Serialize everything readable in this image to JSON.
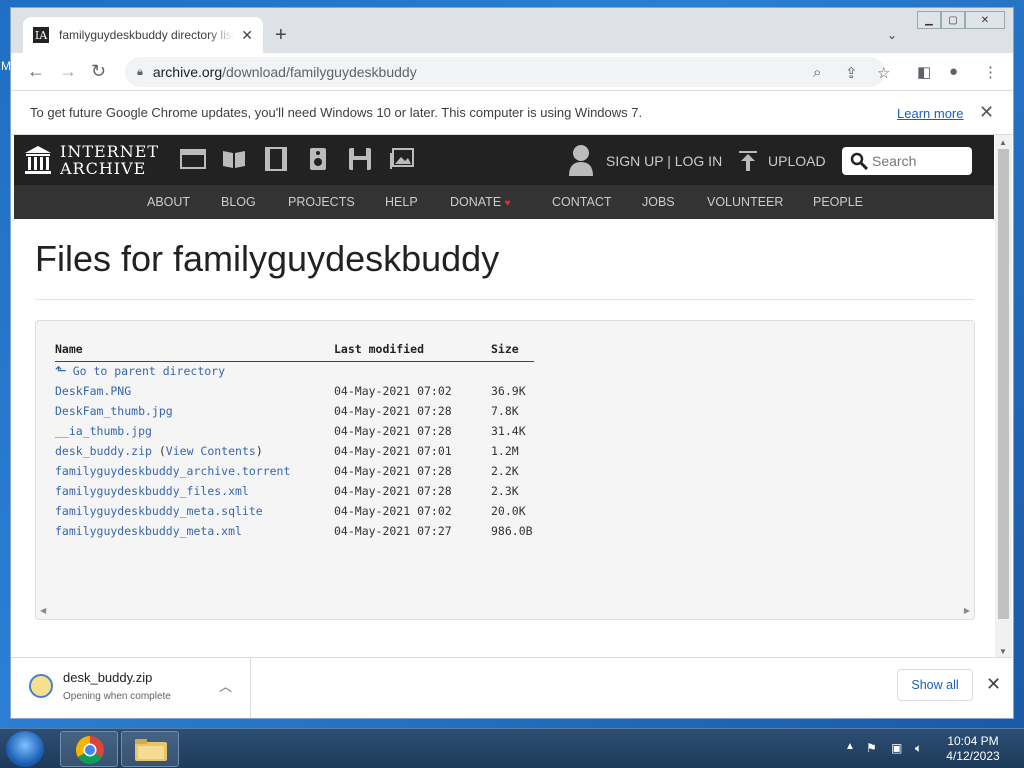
{
  "desktop": {
    "edge_letter": "M"
  },
  "browser": {
    "tab_title": "familyguydeskbuddy directory listing",
    "tab_favicon": "IA",
    "url_host": "archive.org",
    "url_path": "/download/familyguydeskbuddy",
    "infobar_text": "To get future Google Chrome updates, you'll need Windows 10 or later. This computer is using Windows 7.",
    "learn_more": "Learn more"
  },
  "ia_header": {
    "logo_line1": "INTERNET",
    "logo_line2": "ARCHIVE",
    "auth_text": "SIGN UP | LOG IN",
    "upload_text": "UPLOAD",
    "search_placeholder": "Search",
    "nav": [
      "ABOUT",
      "BLOG",
      "PROJECTS",
      "HELP",
      "DONATE",
      "CONTACT",
      "JOBS",
      "VOLUNTEER",
      "PEOPLE"
    ]
  },
  "page": {
    "title": "Files for familyguydeskbuddy",
    "columns": [
      "Name",
      "Last modified",
      "Size"
    ],
    "parent_link": "Go to parent directory",
    "files": [
      {
        "name": "DeskFam.PNG",
        "modified": "04-May-2021 07:02",
        "size": "36.9K"
      },
      {
        "name": "DeskFam_thumb.jpg",
        "modified": "04-May-2021 07:28",
        "size": "7.8K"
      },
      {
        "name": "__ia_thumb.jpg",
        "modified": "04-May-2021 07:28",
        "size": "31.4K"
      },
      {
        "name": "desk_buddy.zip",
        "extra_pre": " (",
        "extra_link": "View Contents",
        "extra_post": ")",
        "modified": "04-May-2021 07:01",
        "size": "1.2M"
      },
      {
        "name": "familyguydeskbuddy_archive.torrent",
        "modified": "04-May-2021 07:28",
        "size": "2.2K"
      },
      {
        "name": "familyguydeskbuddy_files.xml",
        "modified": "04-May-2021 07:28",
        "size": "2.3K"
      },
      {
        "name": "familyguydeskbuddy_meta.sqlite",
        "modified": "04-May-2021 07:02",
        "size": "20.0K"
      },
      {
        "name": "familyguydeskbuddy_meta.xml",
        "modified": "04-May-2021 07:27",
        "size": "986.0B"
      }
    ]
  },
  "download_bar": {
    "file_name": "desk_buddy.zip",
    "status": "Opening when complete",
    "show_all": "Show all"
  },
  "taskbar": {
    "time": "10:04 PM",
    "date": "4/12/2023"
  },
  "colors": {
    "ia_bar": "#222222",
    "ia_nav": "#333333",
    "link": "#3766b0"
  }
}
